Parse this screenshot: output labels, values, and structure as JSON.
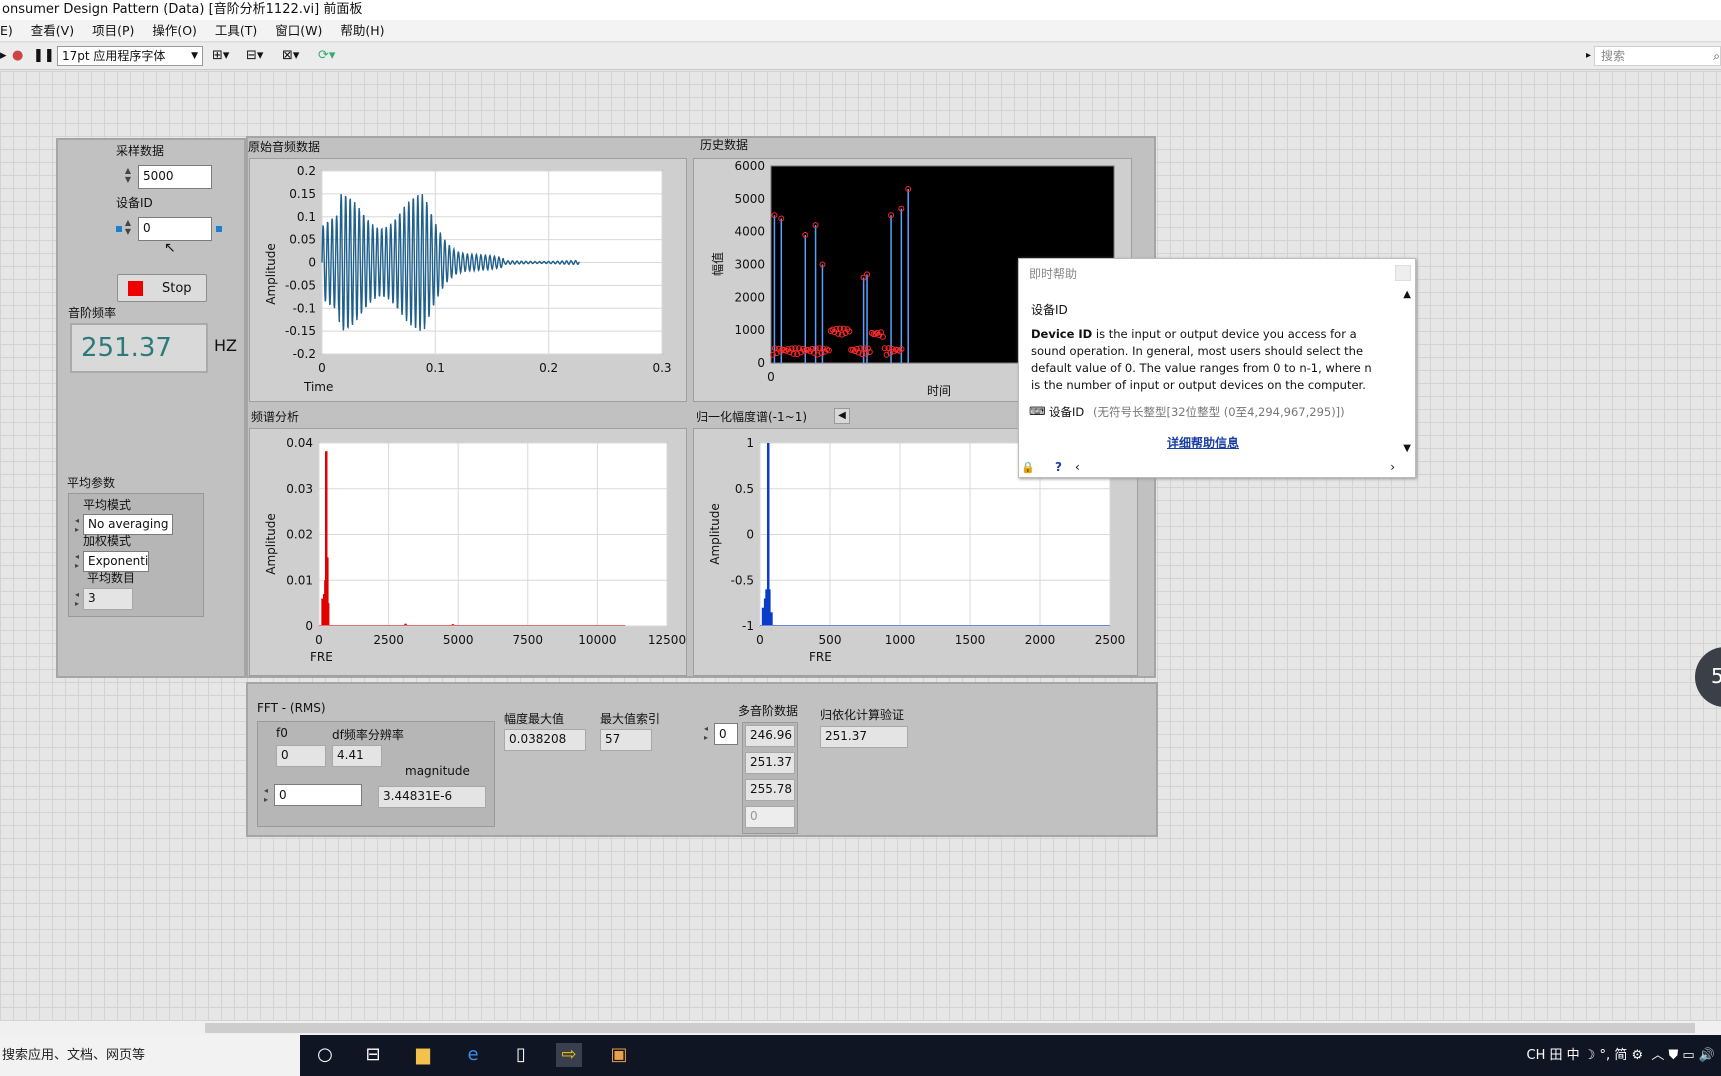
{
  "window": {
    "title": "onsumer Design Pattern (Data) [音阶分析1122.vi] 前面板"
  },
  "menu": [
    "E)",
    "查看(V)",
    "项目(P)",
    "操作(O)",
    "工具(T)",
    "窗口(W)",
    "帮助(H)"
  ],
  "toolbar": {
    "font": "17pt 应用程序字体",
    "search_placeholder": "搜索"
  },
  "controls": {
    "sample_label": "采样数据",
    "sample_value": "5000",
    "device_label": "设备ID",
    "device_value": "0",
    "stop_label": "Stop",
    "freq_label": "音阶频率",
    "freq_value": "251.37",
    "freq_unit": "HZ",
    "avg_section": "平均参数",
    "avg_mode_label": "平均模式",
    "avg_mode_value": "No averaging",
    "weight_label": "加权模式",
    "weight_value": "Exponenti",
    "avg_count_label": "平均数目",
    "avg_count_value": "3"
  },
  "charts": {
    "raw": {
      "title": "原始音频数据",
      "xlabel": "Time",
      "ylabel": "Amplitude",
      "xticks": [
        "0",
        "0.1",
        "0.2",
        "0.3"
      ],
      "yticks": [
        "0.2",
        "0.15",
        "0.1",
        "0.05",
        "0",
        "-0.05",
        "-0.1",
        "-0.15",
        "-0.2"
      ]
    },
    "history": {
      "title": "历史数据",
      "xlabel": "时间",
      "ylabel": "幅值",
      "xticks": [
        "0"
      ],
      "yticks": [
        "6000",
        "5000",
        "4000",
        "3000",
        "2000",
        "1000",
        "0"
      ]
    },
    "spectrum": {
      "title": "频谱分析",
      "xlabel": "FRE",
      "ylabel": "Amplitude",
      "xticks": [
        "0",
        "2500",
        "5000",
        "7500",
        "10000",
        "12500"
      ],
      "yticks": [
        "0.04",
        "0.03",
        "0.02",
        "0.01",
        "0"
      ]
    },
    "normalized": {
      "title": "归一化幅度谱(-1~1)",
      "xlabel": "FRE",
      "ylabel": "Amplitude",
      "xticks": [
        "0",
        "500",
        "1000",
        "1500",
        "2000",
        "2500"
      ],
      "yticks": [
        "1",
        "0.5",
        "0",
        "-0.5",
        "-1"
      ]
    }
  },
  "chart_data": [
    {
      "type": "line",
      "title": "原始音频数据",
      "xlabel": "Time",
      "ylabel": "Amplitude",
      "xlim": [
        0,
        0.3
      ],
      "ylim": [
        -0.2,
        0.2
      ],
      "series": [
        {
          "x_range": [
            0,
            0.227
          ],
          "peak_amplitude": 0.15
        }
      ]
    },
    {
      "type": "scatter",
      "title": "历史数据",
      "xlabel": "时间",
      "ylabel": "幅值",
      "ylim": [
        0,
        6000
      ],
      "peaks": [
        4500,
        4400,
        3900,
        4200,
        3000,
        2600,
        2700,
        4500,
        4700,
        5300
      ]
    },
    {
      "type": "bar",
      "title": "频谱分析",
      "xlabel": "FRE",
      "ylabel": "Amplitude",
      "xlim": [
        0,
        12500
      ],
      "ylim": [
        0,
        0.04
      ],
      "series": [
        {
          "peak_x": 251.37,
          "peak_y": 0.038208
        }
      ]
    },
    {
      "type": "bar",
      "title": "归一化幅度谱(-1~1)",
      "xlabel": "FRE",
      "ylabel": "Amplitude",
      "xlim": [
        0,
        2500
      ],
      "ylim": [
        -1,
        1
      ],
      "series": [
        {
          "peak_x": 57,
          "peak_y": 1
        }
      ]
    }
  ],
  "fft": {
    "title": "FFT - (RMS)",
    "f0_label": "f0",
    "f0_value": "0",
    "df_label": "df频率分辨率",
    "df_value": "4.41",
    "index_value": "0",
    "magnitude_label": "magnitude",
    "magnitude_value": "3.44831E-6",
    "max_amp_label": "幅度最大值",
    "max_amp_value": "0.038208",
    "max_index_label": "最大值索引",
    "max_index_value": "57",
    "multi_label": "多音阶数据",
    "multi_index": "0",
    "multi_values": [
      "246.96",
      "251.37",
      "255.78",
      "0"
    ],
    "verify_label": "归依化计算验证",
    "verify_value": "251.37"
  },
  "help": {
    "title": "即时帮助",
    "heading": "设备ID",
    "bold": "Device ID",
    "body": " is the input or output device you access for a sound operation. In general, most users should select the default value of 0. The value ranges from 0 to n-1, where n is the number of input or output devices on the computer.",
    "type_name": "设备ID",
    "type_detail": "(无符号长整型[32位整型 (0至4,294,967,295)])",
    "link": "详细帮助信息"
  },
  "taskbar": {
    "search": "搜索应用、文档、网页等",
    "tray": "CH 田 中 ☽ °, 简 ⚙",
    "badge": "5"
  },
  "colors": {
    "wave": "#1f5f8b",
    "spectrum": "#e00000",
    "normalized": "#0a3cc8",
    "history_bg": "#000000",
    "freq_text": "#2c7a7a"
  }
}
